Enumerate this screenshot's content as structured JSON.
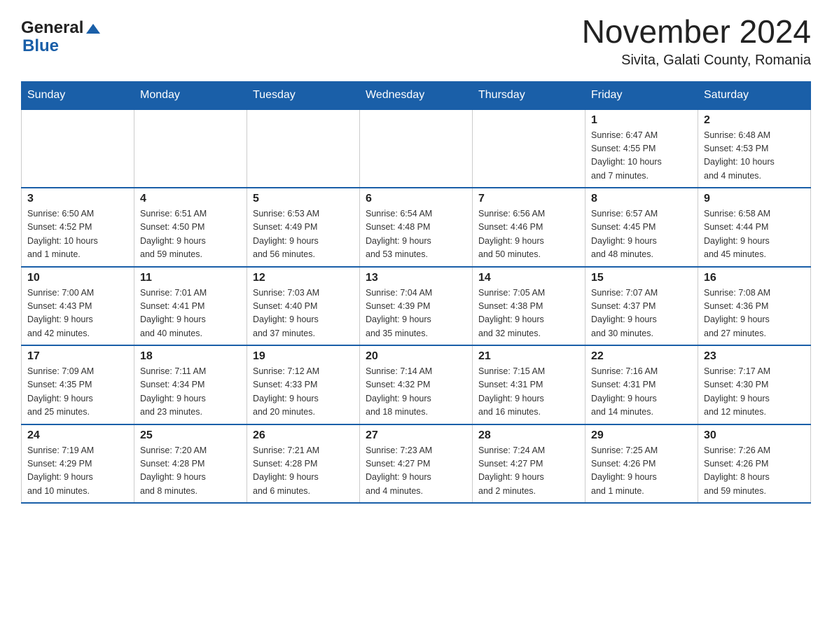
{
  "logo": {
    "general": "General",
    "blue": "Blue"
  },
  "title": "November 2024",
  "subtitle": "Sivita, Galati County, Romania",
  "weekdays": [
    "Sunday",
    "Monday",
    "Tuesday",
    "Wednesday",
    "Thursday",
    "Friday",
    "Saturday"
  ],
  "weeks": [
    [
      {
        "day": "",
        "info": ""
      },
      {
        "day": "",
        "info": ""
      },
      {
        "day": "",
        "info": ""
      },
      {
        "day": "",
        "info": ""
      },
      {
        "day": "",
        "info": ""
      },
      {
        "day": "1",
        "info": "Sunrise: 6:47 AM\nSunset: 4:55 PM\nDaylight: 10 hours\nand 7 minutes."
      },
      {
        "day": "2",
        "info": "Sunrise: 6:48 AM\nSunset: 4:53 PM\nDaylight: 10 hours\nand 4 minutes."
      }
    ],
    [
      {
        "day": "3",
        "info": "Sunrise: 6:50 AM\nSunset: 4:52 PM\nDaylight: 10 hours\nand 1 minute."
      },
      {
        "day": "4",
        "info": "Sunrise: 6:51 AM\nSunset: 4:50 PM\nDaylight: 9 hours\nand 59 minutes."
      },
      {
        "day": "5",
        "info": "Sunrise: 6:53 AM\nSunset: 4:49 PM\nDaylight: 9 hours\nand 56 minutes."
      },
      {
        "day": "6",
        "info": "Sunrise: 6:54 AM\nSunset: 4:48 PM\nDaylight: 9 hours\nand 53 minutes."
      },
      {
        "day": "7",
        "info": "Sunrise: 6:56 AM\nSunset: 4:46 PM\nDaylight: 9 hours\nand 50 minutes."
      },
      {
        "day": "8",
        "info": "Sunrise: 6:57 AM\nSunset: 4:45 PM\nDaylight: 9 hours\nand 48 minutes."
      },
      {
        "day": "9",
        "info": "Sunrise: 6:58 AM\nSunset: 4:44 PM\nDaylight: 9 hours\nand 45 minutes."
      }
    ],
    [
      {
        "day": "10",
        "info": "Sunrise: 7:00 AM\nSunset: 4:43 PM\nDaylight: 9 hours\nand 42 minutes."
      },
      {
        "day": "11",
        "info": "Sunrise: 7:01 AM\nSunset: 4:41 PM\nDaylight: 9 hours\nand 40 minutes."
      },
      {
        "day": "12",
        "info": "Sunrise: 7:03 AM\nSunset: 4:40 PM\nDaylight: 9 hours\nand 37 minutes."
      },
      {
        "day": "13",
        "info": "Sunrise: 7:04 AM\nSunset: 4:39 PM\nDaylight: 9 hours\nand 35 minutes."
      },
      {
        "day": "14",
        "info": "Sunrise: 7:05 AM\nSunset: 4:38 PM\nDaylight: 9 hours\nand 32 minutes."
      },
      {
        "day": "15",
        "info": "Sunrise: 7:07 AM\nSunset: 4:37 PM\nDaylight: 9 hours\nand 30 minutes."
      },
      {
        "day": "16",
        "info": "Sunrise: 7:08 AM\nSunset: 4:36 PM\nDaylight: 9 hours\nand 27 minutes."
      }
    ],
    [
      {
        "day": "17",
        "info": "Sunrise: 7:09 AM\nSunset: 4:35 PM\nDaylight: 9 hours\nand 25 minutes."
      },
      {
        "day": "18",
        "info": "Sunrise: 7:11 AM\nSunset: 4:34 PM\nDaylight: 9 hours\nand 23 minutes."
      },
      {
        "day": "19",
        "info": "Sunrise: 7:12 AM\nSunset: 4:33 PM\nDaylight: 9 hours\nand 20 minutes."
      },
      {
        "day": "20",
        "info": "Sunrise: 7:14 AM\nSunset: 4:32 PM\nDaylight: 9 hours\nand 18 minutes."
      },
      {
        "day": "21",
        "info": "Sunrise: 7:15 AM\nSunset: 4:31 PM\nDaylight: 9 hours\nand 16 minutes."
      },
      {
        "day": "22",
        "info": "Sunrise: 7:16 AM\nSunset: 4:31 PM\nDaylight: 9 hours\nand 14 minutes."
      },
      {
        "day": "23",
        "info": "Sunrise: 7:17 AM\nSunset: 4:30 PM\nDaylight: 9 hours\nand 12 minutes."
      }
    ],
    [
      {
        "day": "24",
        "info": "Sunrise: 7:19 AM\nSunset: 4:29 PM\nDaylight: 9 hours\nand 10 minutes."
      },
      {
        "day": "25",
        "info": "Sunrise: 7:20 AM\nSunset: 4:28 PM\nDaylight: 9 hours\nand 8 minutes."
      },
      {
        "day": "26",
        "info": "Sunrise: 7:21 AM\nSunset: 4:28 PM\nDaylight: 9 hours\nand 6 minutes."
      },
      {
        "day": "27",
        "info": "Sunrise: 7:23 AM\nSunset: 4:27 PM\nDaylight: 9 hours\nand 4 minutes."
      },
      {
        "day": "28",
        "info": "Sunrise: 7:24 AM\nSunset: 4:27 PM\nDaylight: 9 hours\nand 2 minutes."
      },
      {
        "day": "29",
        "info": "Sunrise: 7:25 AM\nSunset: 4:26 PM\nDaylight: 9 hours\nand 1 minute."
      },
      {
        "day": "30",
        "info": "Sunrise: 7:26 AM\nSunset: 4:26 PM\nDaylight: 8 hours\nand 59 minutes."
      }
    ]
  ]
}
